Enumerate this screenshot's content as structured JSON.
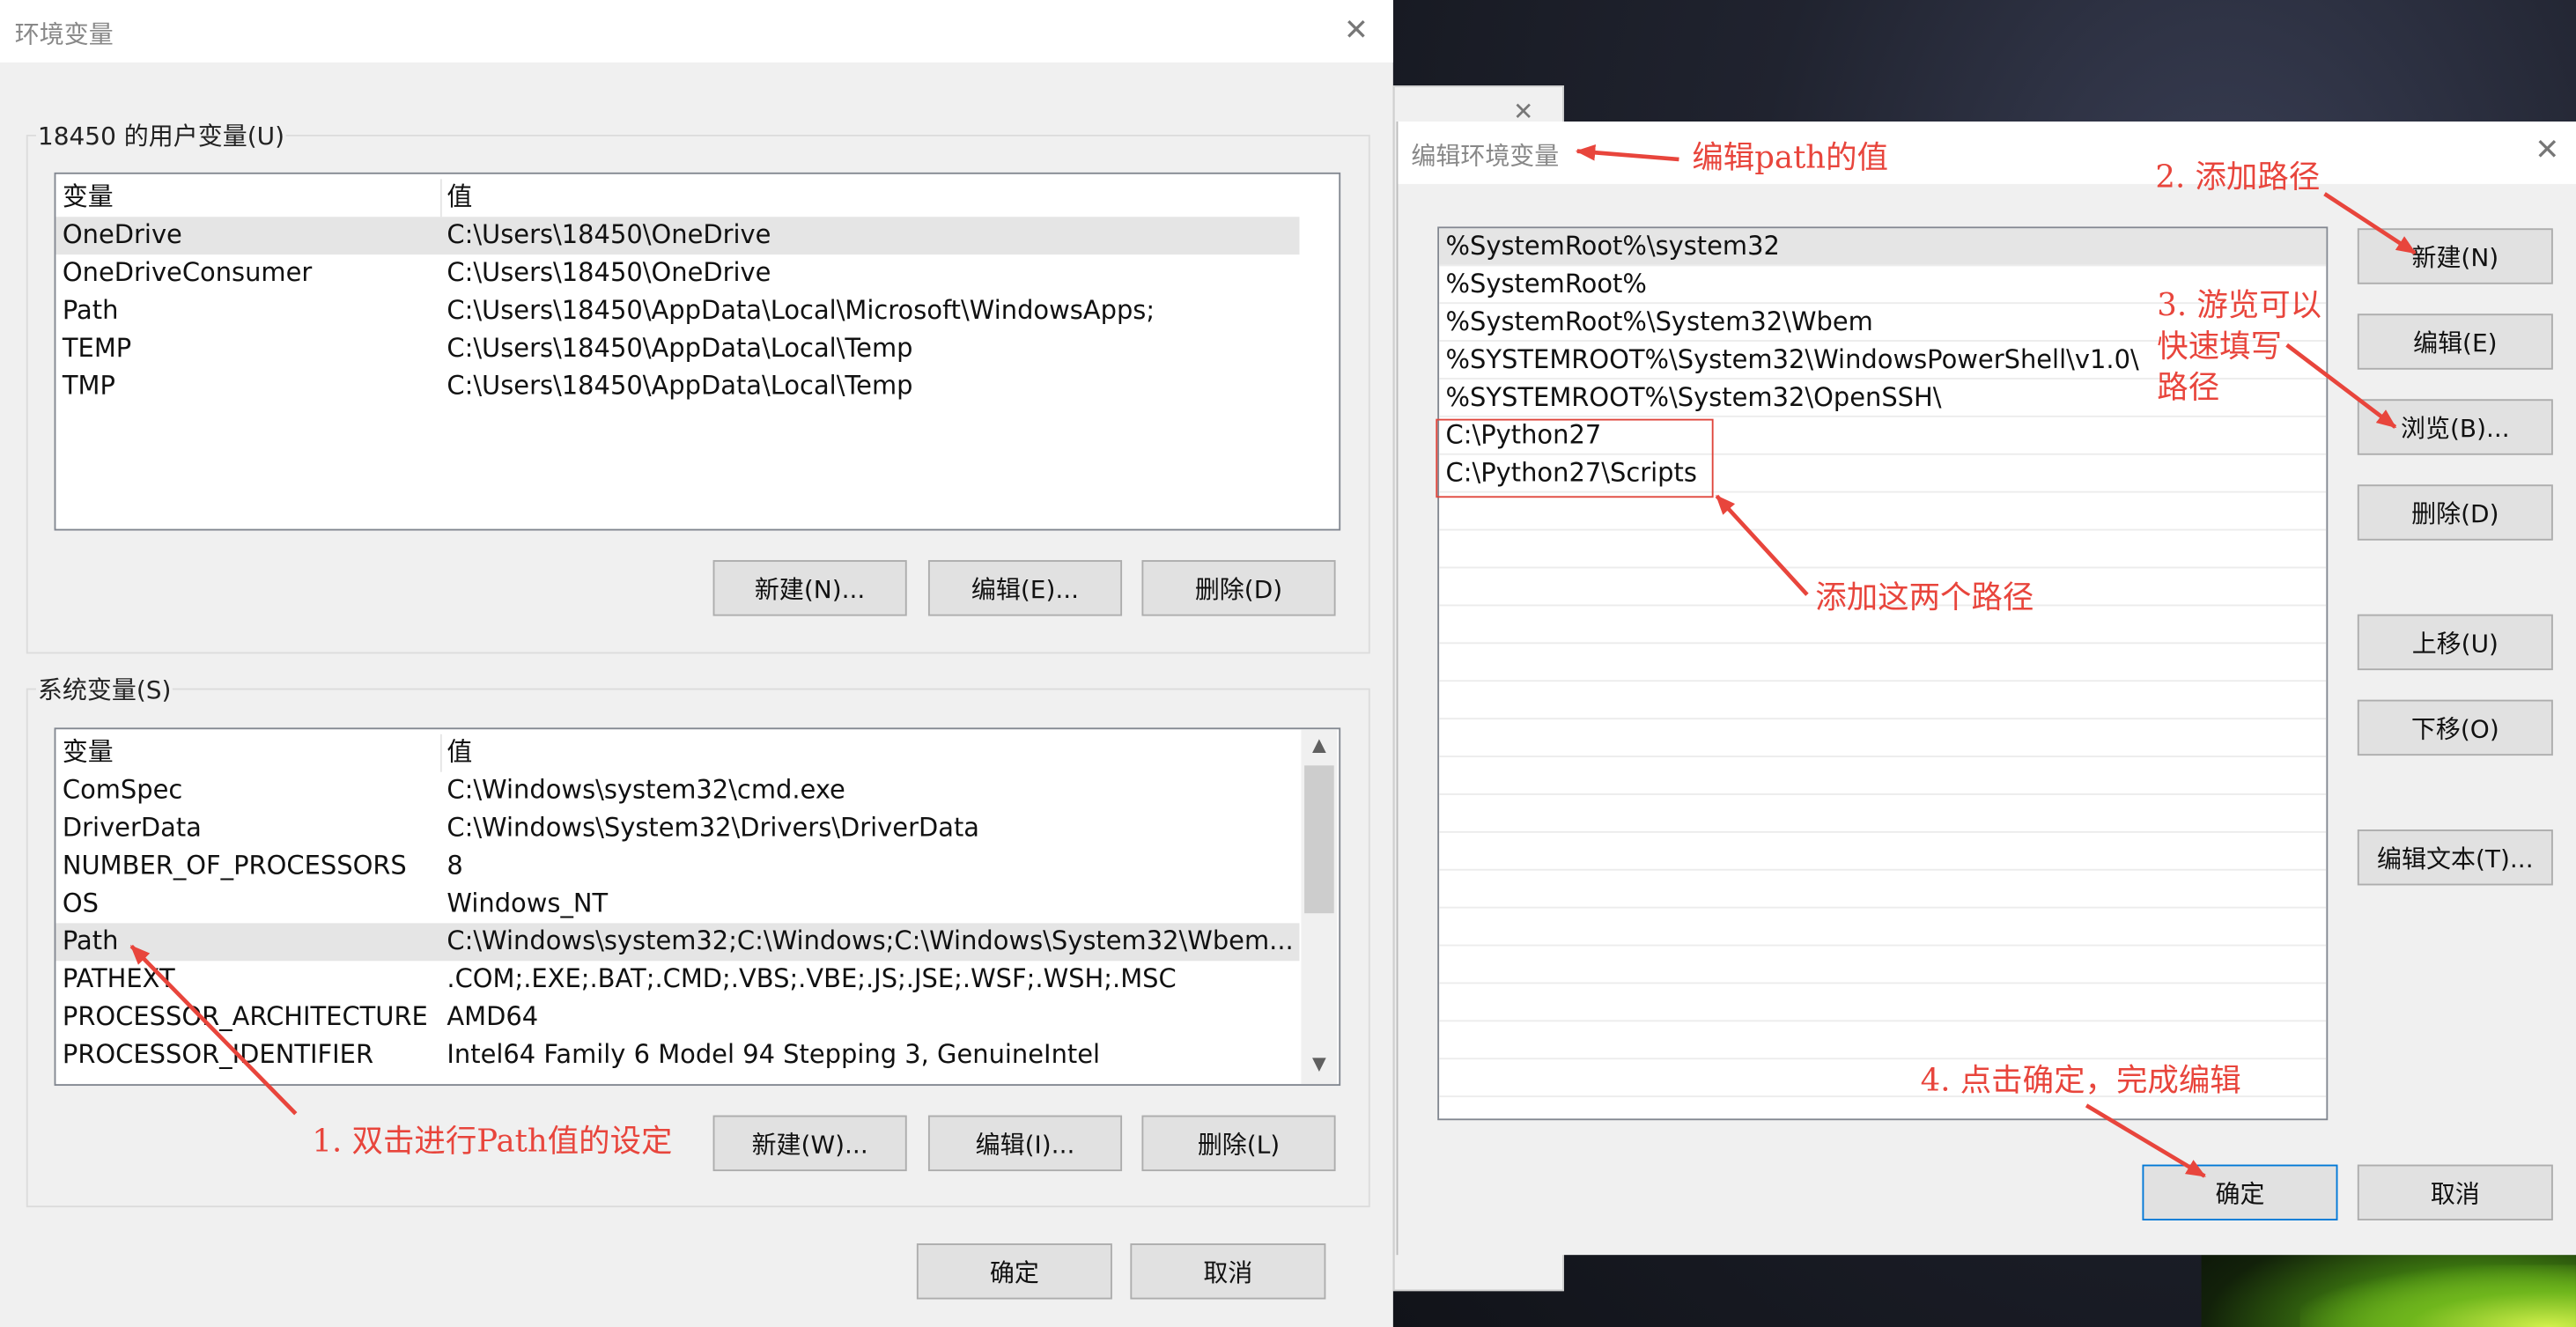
{
  "env_dialog": {
    "title": "环境变量",
    "user_group_label": "18450 的用户变量(U)",
    "user_columns": [
      "变量",
      "值"
    ],
    "user_rows": [
      {
        "name": "OneDrive",
        "value": "C:\\Users\\18450\\OneDrive"
      },
      {
        "name": "OneDriveConsumer",
        "value": "C:\\Users\\18450\\OneDrive"
      },
      {
        "name": "Path",
        "value": "C:\\Users\\18450\\AppData\\Local\\Microsoft\\WindowsApps;"
      },
      {
        "name": "TEMP",
        "value": "C:\\Users\\18450\\AppData\\Local\\Temp"
      },
      {
        "name": "TMP",
        "value": "C:\\Users\\18450\\AppData\\Local\\Temp"
      }
    ],
    "user_buttons": {
      "new": "新建(N)...",
      "edit": "编辑(E)...",
      "delete": "删除(D)"
    },
    "system_group_label": "系统变量(S)",
    "system_columns": [
      "变量",
      "值"
    ],
    "system_rows": [
      {
        "name": "ComSpec",
        "value": "C:\\Windows\\system32\\cmd.exe"
      },
      {
        "name": "DriverData",
        "value": "C:\\Windows\\System32\\Drivers\\DriverData"
      },
      {
        "name": "NUMBER_OF_PROCESSORS",
        "value": "8"
      },
      {
        "name": "OS",
        "value": "Windows_NT"
      },
      {
        "name": "Path",
        "value": "C:\\Windows\\system32;C:\\Windows;C:\\Windows\\System32\\Wbem..."
      },
      {
        "name": "PATHEXT",
        "value": ".COM;.EXE;.BAT;.CMD;.VBS;.VBE;.JS;.JSE;.WSF;.WSH;.MSC"
      },
      {
        "name": "PROCESSOR_ARCHITECTURE",
        "value": "AMD64"
      },
      {
        "name": "PROCESSOR_IDENTIFIER",
        "value": "Intel64 Family 6 Model 94 Stepping 3, GenuineIntel"
      }
    ],
    "system_buttons": {
      "new": "新建(W)...",
      "edit": "编辑(I)...",
      "delete": "删除(L)"
    },
    "ok": "确定",
    "cancel": "取消"
  },
  "edit_dialog": {
    "title": "编辑环境变量",
    "paths": [
      "%SystemRoot%\\system32",
      "%SystemRoot%",
      "%SystemRoot%\\System32\\Wbem",
      "%SYSTEMROOT%\\System32\\WindowsPowerShell\\v1.0\\",
      "%SYSTEMROOT%\\System32\\OpenSSH\\",
      "C:\\Python27",
      "C:\\Python27\\Scripts"
    ],
    "buttons": {
      "new": "新建(N)",
      "edit": "编辑(E)",
      "browse": "浏览(B)...",
      "delete": "删除(D)",
      "move_up": "上移(U)",
      "move_down": "下移(O)",
      "edit_text": "编辑文本(T)..."
    },
    "ok": "确定",
    "cancel": "取消"
  },
  "annotations": {
    "edit_path": "编辑path的值",
    "step2": "2. 添加路径",
    "step3_line1": "3. 游览可以",
    "step3_line2": "快速填写",
    "step3_line3": "路径",
    "add_two": "添加这两个路径",
    "step1": "1. 双击进行Path值的设定",
    "step4": "4. 点击确定，完成编辑"
  },
  "colors": {
    "annotation": "#e8453c",
    "dialog_bg": "#f0f0f0",
    "default_button_border": "#0078d7"
  }
}
